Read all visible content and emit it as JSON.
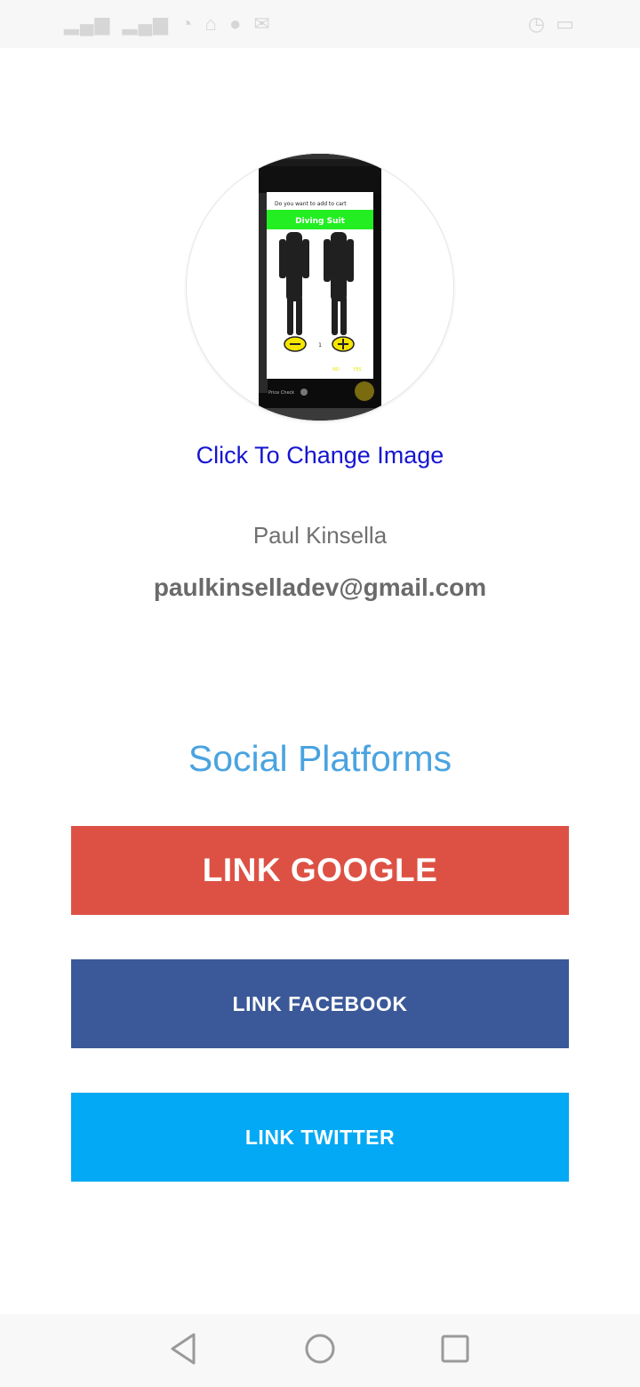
{
  "status_bar": {
    "left_icons": [
      "signal-icon",
      "signal-icon",
      "wifi-icon",
      "home-icon",
      "person-icon",
      "mail-icon"
    ],
    "right_icons": [
      "alarm-icon",
      "battery-icon"
    ]
  },
  "profile": {
    "photo_caption": "Diving Suit",
    "photo_prompt": "Do you want to add to cart",
    "photo_quantity": "1",
    "photo_buttons": [
      "NO",
      "YES"
    ],
    "photo_toggle_label": "Price Check",
    "change_image_label": "Click To Change Image",
    "name": "Paul Kinsella",
    "email": "paulkinselladev@gmail.com"
  },
  "social": {
    "title": "Social Platforms",
    "buttons": [
      {
        "label": "LINK GOOGLE",
        "color": "#dd5144"
      },
      {
        "label": "LINK FACEBOOK",
        "color": "#3b5998"
      },
      {
        "label": "LINK TWITTER",
        "color": "#03a9f4"
      }
    ]
  },
  "colors": {
    "link": "#1515d0",
    "section_title": "#4aa3e0"
  },
  "nav_bar": {
    "buttons": [
      "back-icon",
      "home-icon",
      "recents-icon"
    ]
  }
}
